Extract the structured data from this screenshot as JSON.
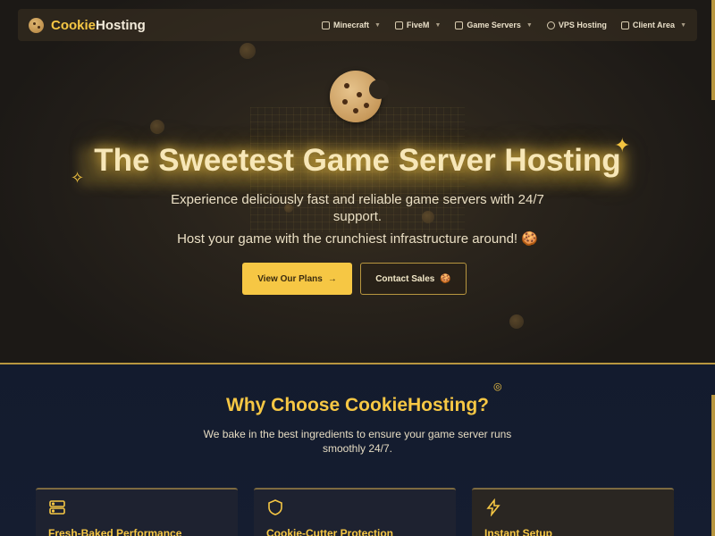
{
  "nav": {
    "brand_part1": "Cookie",
    "brand_part2": "Hosting",
    "items": [
      {
        "label": "Minecraft",
        "icon": "server-icon",
        "dropdown": true
      },
      {
        "label": "FiveM",
        "icon": "server-icon",
        "dropdown": true
      },
      {
        "label": "Game Servers",
        "icon": "server-icon",
        "dropdown": true
      },
      {
        "label": "VPS Hosting",
        "icon": "globe-icon",
        "dropdown": false
      },
      {
        "label": "Client Area",
        "icon": "layout-icon",
        "dropdown": true
      }
    ]
  },
  "hero": {
    "title": "The Sweetest Game Server Hosting",
    "subtitle": "Experience deliciously fast and reliable game servers with 24/7 support.",
    "tagline": "Host your game with the crunchiest infrastructure around!",
    "primary_button": "View Our Plans",
    "secondary_button": "Contact Sales"
  },
  "features": {
    "title": "Why Choose CookieHosting?",
    "subtitle": "We bake in the best ingredients to ensure your game server runs smoothly 24/7.",
    "cards": [
      {
        "title": "Fresh-Baked Performance",
        "icon": "server-icon"
      },
      {
        "title": "Cookie-Cutter Protection",
        "icon": "shield-icon"
      },
      {
        "title": "Instant Setup",
        "icon": "lightning-icon"
      }
    ]
  },
  "colors": {
    "accent": "#f6c744",
    "hero_bg": "#2a241c",
    "features_bg": "#131b2e"
  }
}
